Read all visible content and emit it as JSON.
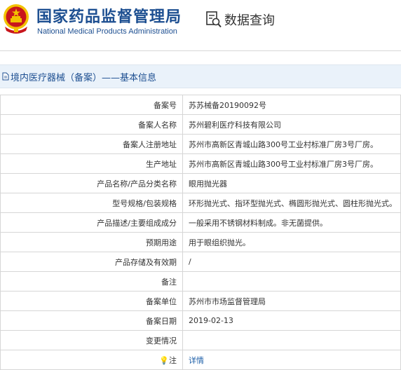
{
  "header": {
    "title_cn": "国家药品监督管理局",
    "title_en": "National Medical Products Administration",
    "query_label": "数据查询",
    "emblem_icon": "national-emblem-icon",
    "query_icon": "document-search-icon"
  },
  "section": {
    "icon": "document-icon",
    "title": "境内医疗器械（备案）——基本信息"
  },
  "rows": [
    {
      "label": "备案号",
      "value": "苏苏械备20190092号"
    },
    {
      "label": "备案人名称",
      "value": "苏州碧利医疗科技有限公司"
    },
    {
      "label": "备案人注册地址",
      "value": "苏州市高新区青城山路300号工业村标准厂房3号厂房。"
    },
    {
      "label": "生产地址",
      "value": "苏州市高新区青城山路300号工业村标准厂房3号厂房。"
    },
    {
      "label": "产品名称/产品分类名称",
      "value": "眼用抛光器"
    },
    {
      "label": "型号规格/包装规格",
      "value": "环形抛光式、指环型抛光式、椭圆形抛光式、圆柱形抛光式。"
    },
    {
      "label": "产品描述/主要组成成分",
      "value": "一般采用不锈钢材料制成。非无菌提供。"
    },
    {
      "label": "预期用途",
      "value": "用于眼组织抛光。"
    },
    {
      "label": "产品存储及有效期",
      "value": "/"
    },
    {
      "label": "备注",
      "value": ""
    },
    {
      "label": "备案单位",
      "value": "苏州市市场监督管理局"
    },
    {
      "label": "备案日期",
      "value": "2019-02-13"
    },
    {
      "label": "变更情况",
      "value": ""
    }
  ],
  "footer_row": {
    "label": "注",
    "icon": "lightbulb-icon",
    "link_text": "详情"
  },
  "colors": {
    "brand_blue": "#1d4f91",
    "section_bg": "#eaf2fa",
    "border": "#d6d6d6",
    "emblem_red": "#c8161d",
    "emblem_gold": "#f2c200"
  }
}
